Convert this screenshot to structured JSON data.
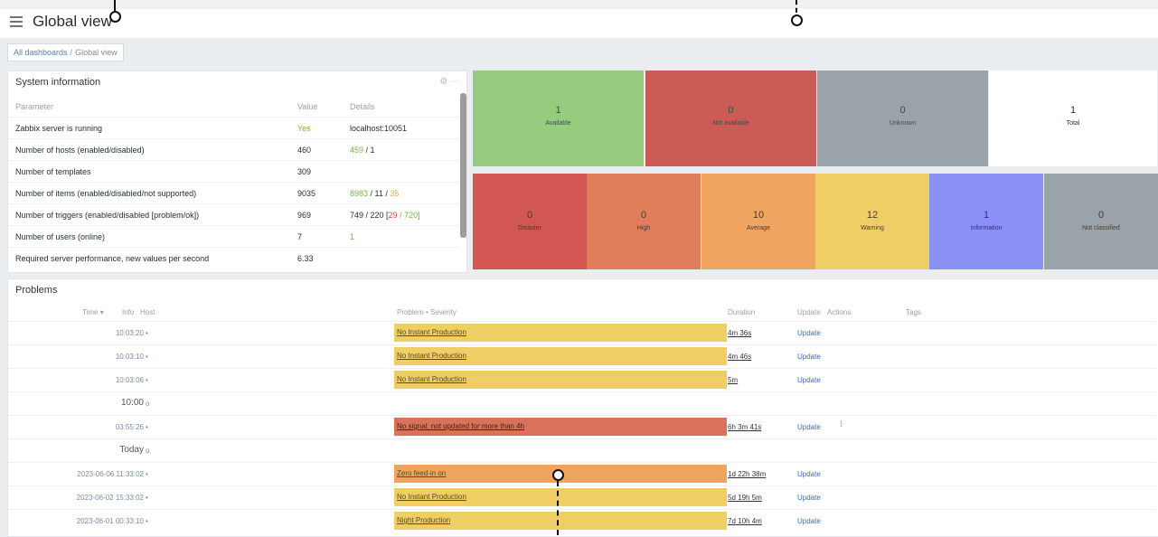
{
  "header": {
    "title": "Global view"
  },
  "breadcrumb": {
    "root": "All dashboards",
    "separator": "/",
    "current": "Global view"
  },
  "system_info": {
    "title": "System information",
    "headers": {
      "parameter": "Parameter",
      "value": "Value",
      "details": "Details"
    },
    "rows": [
      {
        "parameter": "Zabbix server is running",
        "value": "Yes",
        "details_a": "localhost:10051",
        "details_b": "",
        "details_c": "",
        "value_color": "#7bb34b"
      },
      {
        "parameter": "Number of hosts (enabled/disabled)",
        "value": "460",
        "details_a": "459",
        "details_b": " / 1",
        "details_c": "",
        "value_color": "#1f2c33"
      },
      {
        "parameter": "Number of templates",
        "value": "309",
        "details_a": "",
        "details_b": "",
        "details_c": "",
        "value_color": "#1f2c33"
      },
      {
        "parameter": "Number of items (enabled/disabled/not supported)",
        "value": "9035",
        "details_a": "8983",
        "details_b": " / 11 / ",
        "details_c": "35",
        "value_color": "#1f2c33"
      },
      {
        "parameter": "Number of triggers (enabled/disabled [problem/ok])",
        "value": "969",
        "details_a": "749 / 220 [",
        "details_b": "29",
        "details_c": " / 720]",
        "value_color": "#1f2c33"
      },
      {
        "parameter": "Number of users (online)",
        "value": "7",
        "details_a": "1",
        "details_b": "",
        "details_c": "",
        "value_color": "#1f2c33"
      },
      {
        "parameter": "Required server performance, new values per second",
        "value": "6.33",
        "details_a": "",
        "details_b": "",
        "details_c": "",
        "value_color": "#1f2c33"
      }
    ]
  },
  "host_availability": [
    {
      "count": "1",
      "label": "Available",
      "color": "#97cc7f"
    },
    {
      "count": "0",
      "label": "Not available",
      "color": "#cc5b56"
    },
    {
      "count": "0",
      "label": "Unknown",
      "color": "#9aa2aa"
    },
    {
      "count": "1",
      "label": "Total",
      "color": "#ffffff"
    }
  ],
  "problems_by_severity": [
    {
      "count": "0",
      "label": "Disaster",
      "color": "#d25652"
    },
    {
      "count": "0",
      "label": "High",
      "color": "#e07e5c"
    },
    {
      "count": "10",
      "label": "Average",
      "color": "#efa45f"
    },
    {
      "count": "12",
      "label": "Warning",
      "color": "#efce66"
    },
    {
      "count": "1",
      "label": "Information",
      "color": "#8a90f5"
    },
    {
      "count": "0",
      "label": "Not classified",
      "color": "#9aa2aa"
    }
  ],
  "problems": {
    "title": "Problems",
    "headers": {
      "time": "Time ▾",
      "info": "Info",
      "host": "Host",
      "problem": "Problem • Severity",
      "duration": "Duration",
      "update": "Update",
      "actions": "Actions",
      "tags": "Tags"
    },
    "rows": [
      {
        "type": "event",
        "time": "10:03:20",
        "problem": "No Instant Production",
        "duration": "4m 36s",
        "update": "Update",
        "color": "#efce66"
      },
      {
        "type": "event",
        "time": "10:03:10",
        "problem": "No Instant Production",
        "duration": "4m 46s",
        "update": "Update",
        "color": "#efce66"
      },
      {
        "type": "event",
        "time": "10:03:06",
        "problem": "No Instant Production",
        "duration": "5m",
        "update": "Update",
        "color": "#efce66"
      },
      {
        "type": "header",
        "time": "10:00"
      },
      {
        "type": "event",
        "time": "03:55:26",
        "problem": "No signal: not updated for more than 4h",
        "duration": "6h 3m 41s",
        "update": "Update",
        "color": "#d8725a",
        "action": "⁝"
      },
      {
        "type": "header",
        "time": "Today"
      },
      {
        "type": "event",
        "time": "2023-06-06 11:33:02",
        "problem": "Zero feed-in on",
        "duration": "1d 22h 38m",
        "update": "Update",
        "color": "#efa45f"
      },
      {
        "type": "event",
        "time": "2023-06-02 15:33:02",
        "problem": "No Instant Production",
        "duration": "5d 19h 5m",
        "update": "Update",
        "color": "#efce66"
      },
      {
        "type": "event",
        "time": "2023-06-01 00:33:10",
        "problem": "Night Production",
        "duration": "7d 10h 4m",
        "update": "Update",
        "color": "#efce66"
      }
    ]
  }
}
